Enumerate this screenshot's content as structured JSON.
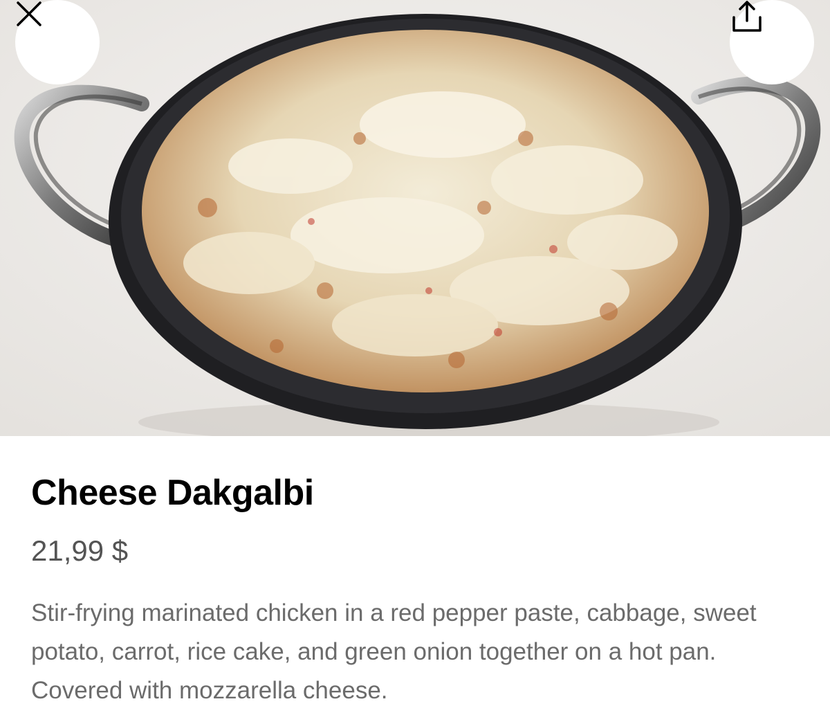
{
  "item": {
    "name": "Cheese Dakgalbi",
    "price": "21,99 $",
    "description": "Stir-frying marinated chicken in a red pepper paste, cabbage, sweet potato, carrot, rice cake, and green onion together on a hot pan. Covered with mozzarella cheese."
  },
  "hero": {
    "image_subject": "cheese dakgalbi in a black pan with handles"
  },
  "icons": {
    "close": "close-icon",
    "share": "share-icon"
  },
  "colors": {
    "title": "#000000",
    "price": "#545454",
    "description": "#6b6b6b",
    "button_bg": "#ffffff"
  }
}
